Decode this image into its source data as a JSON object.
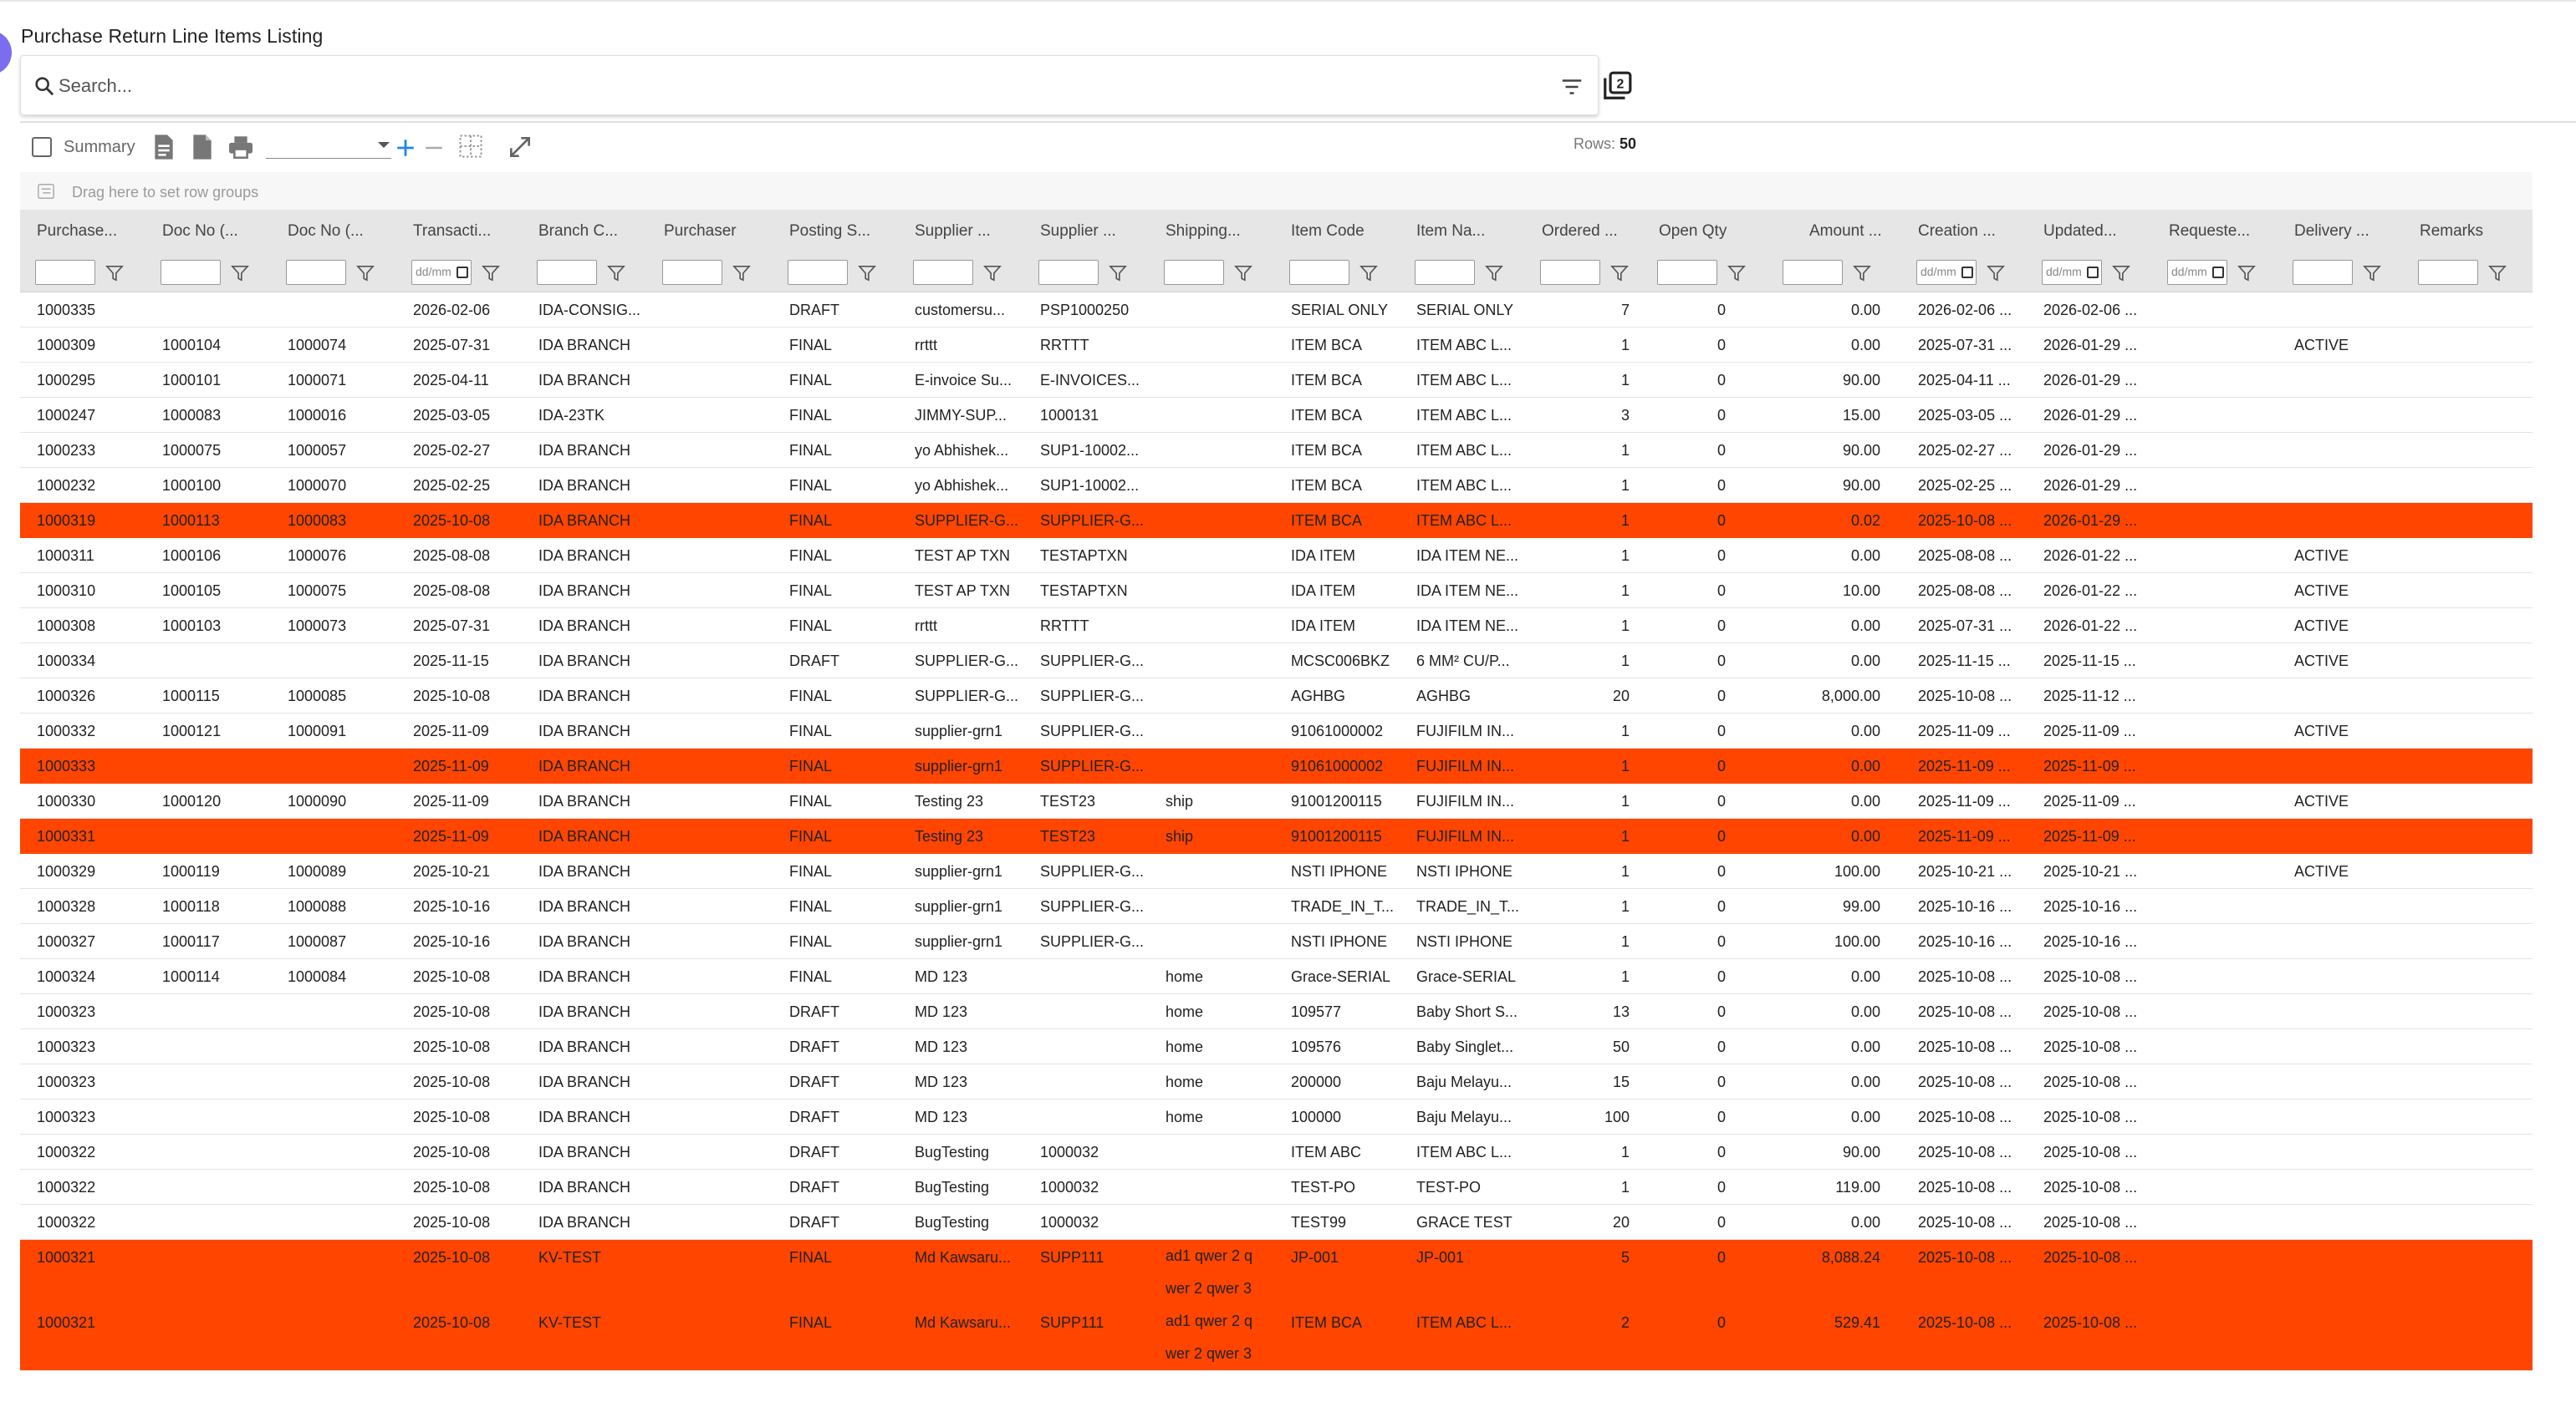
{
  "page": {
    "title": "Purchase Return Line Items Listing"
  },
  "search": {
    "placeholder": "Search..."
  },
  "toolbar": {
    "summary_label": "Summary",
    "rows_label": "Rows:",
    "rows_value": "50"
  },
  "group_panel": {
    "hint": "Drag here to set row groups"
  },
  "colors": {
    "highlight": "#ff4500",
    "header_bg": "#e6e6e6",
    "accent_blue": "#1e88e5"
  },
  "columns": [
    {
      "label": "Purchase...",
      "filter": "text"
    },
    {
      "label": "Doc No (...",
      "filter": "text"
    },
    {
      "label": "Doc No (...",
      "filter": "text"
    },
    {
      "label": "Transacti...",
      "filter": "date"
    },
    {
      "label": "Branch C...",
      "filter": "text"
    },
    {
      "label": "Purchaser",
      "filter": "text"
    },
    {
      "label": "Posting S...",
      "filter": "text"
    },
    {
      "label": "Supplier ...",
      "filter": "text"
    },
    {
      "label": "Supplier ...",
      "filter": "text"
    },
    {
      "label": "Shipping...",
      "filter": "text"
    },
    {
      "label": "Item Code",
      "filter": "text"
    },
    {
      "label": "Item Na...",
      "filter": "text"
    },
    {
      "label": "Ordered ...",
      "filter": "text"
    },
    {
      "label": "Open Qty",
      "filter": "text"
    },
    {
      "label": "Amount ...",
      "filter": "text"
    },
    {
      "label": "Creation ...",
      "filter": "date"
    },
    {
      "label": "Updated...",
      "filter": "date"
    },
    {
      "label": "Requeste...",
      "filter": "date"
    },
    {
      "label": "Delivery ...",
      "filter": "text"
    },
    {
      "label": "Remarks",
      "filter": "text"
    }
  ],
  "date_placeholder": "dd/mm/yyyy",
  "rows": [
    {
      "hl": false,
      "cells": [
        "1000335",
        "",
        "",
        "2026-02-06",
        "IDA-CONSIG...",
        "",
        "DRAFT",
        "customersu...",
        "PSP1000250",
        "",
        "SERIAL ONLY",
        "SERIAL ONLY",
        "7",
        "0",
        "0.00",
        "2026-02-06 ...",
        "2026-02-06 ...",
        "",
        "",
        ""
      ]
    },
    {
      "hl": false,
      "cells": [
        "1000309",
        "1000104",
        "1000074",
        "2025-07-31",
        "IDA BRANCH",
        "",
        "FINAL",
        "rrttt",
        "RRTTT",
        "",
        "ITEM BCA",
        "ITEM ABC L...",
        "1",
        "0",
        "0.00",
        "2025-07-31 ...",
        "2026-01-29 ...",
        "",
        "ACTIVE",
        ""
      ]
    },
    {
      "hl": false,
      "cells": [
        "1000295",
        "1000101",
        "1000071",
        "2025-04-11",
        "IDA BRANCH",
        "",
        "FINAL",
        "E-invoice Su...",
        "E-INVOICES...",
        "",
        "ITEM BCA",
        "ITEM ABC L...",
        "1",
        "0",
        "90.00",
        "2025-04-11 ...",
        "2026-01-29 ...",
        "",
        "",
        ""
      ]
    },
    {
      "hl": false,
      "cells": [
        "1000247",
        "1000083",
        "1000016",
        "2025-03-05",
        "IDA-23TK",
        "",
        "FINAL",
        "JIMMY-SUP...",
        "1000131",
        "",
        "ITEM BCA",
        "ITEM ABC L...",
        "3",
        "0",
        "15.00",
        "2025-03-05 ...",
        "2026-01-29 ...",
        "",
        "",
        ""
      ]
    },
    {
      "hl": false,
      "cells": [
        "1000233",
        "1000075",
        "1000057",
        "2025-02-27",
        "IDA BRANCH",
        "",
        "FINAL",
        "yo Abhishek...",
        "SUP1-10002...",
        "",
        "ITEM BCA",
        "ITEM ABC L...",
        "1",
        "0",
        "90.00",
        "2025-02-27 ...",
        "2026-01-29 ...",
        "",
        "",
        ""
      ]
    },
    {
      "hl": false,
      "cells": [
        "1000232",
        "1000100",
        "1000070",
        "2025-02-25",
        "IDA BRANCH",
        "",
        "FINAL",
        "yo Abhishek...",
        "SUP1-10002...",
        "",
        "ITEM BCA",
        "ITEM ABC L...",
        "1",
        "0",
        "90.00",
        "2025-02-25 ...",
        "2026-01-29 ...",
        "",
        "",
        ""
      ]
    },
    {
      "hl": true,
      "cells": [
        "1000319",
        "1000113",
        "1000083",
        "2025-10-08",
        "IDA BRANCH",
        "",
        "FINAL",
        "SUPPLIER-G...",
        "SUPPLIER-G...",
        "",
        "ITEM BCA",
        "ITEM ABC L...",
        "1",
        "0",
        "0.02",
        "2025-10-08 ...",
        "2026-01-29 ...",
        "",
        "",
        ""
      ]
    },
    {
      "hl": false,
      "cells": [
        "1000311",
        "1000106",
        "1000076",
        "2025-08-08",
        "IDA BRANCH",
        "",
        "FINAL",
        "TEST AP TXN",
        "TESTAPTXN",
        "",
        "IDA ITEM",
        "IDA ITEM NE...",
        "1",
        "0",
        "0.00",
        "2025-08-08 ...",
        "2026-01-22 ...",
        "",
        "ACTIVE",
        ""
      ]
    },
    {
      "hl": false,
      "cells": [
        "1000310",
        "1000105",
        "1000075",
        "2025-08-08",
        "IDA BRANCH",
        "",
        "FINAL",
        "TEST AP TXN",
        "TESTAPTXN",
        "",
        "IDA ITEM",
        "IDA ITEM NE...",
        "1",
        "0",
        "10.00",
        "2025-08-08 ...",
        "2026-01-22 ...",
        "",
        "ACTIVE",
        ""
      ]
    },
    {
      "hl": false,
      "cells": [
        "1000308",
        "1000103",
        "1000073",
        "2025-07-31",
        "IDA BRANCH",
        "",
        "FINAL",
        "rrttt",
        "RRTTT",
        "",
        "IDA ITEM",
        "IDA ITEM NE...",
        "1",
        "0",
        "0.00",
        "2025-07-31 ...",
        "2026-01-22 ...",
        "",
        "ACTIVE",
        ""
      ]
    },
    {
      "hl": false,
      "cells": [
        "1000334",
        "",
        "",
        "2025-11-15",
        "IDA BRANCH",
        "",
        "DRAFT",
        "SUPPLIER-G...",
        "SUPPLIER-G...",
        "",
        "MCSC006BKZ",
        "6 MM² CU/P...",
        "1",
        "0",
        "0.00",
        "2025-11-15 ...",
        "2025-11-15 ...",
        "",
        "ACTIVE",
        ""
      ]
    },
    {
      "hl": false,
      "cells": [
        "1000326",
        "1000115",
        "1000085",
        "2025-10-08",
        "IDA BRANCH",
        "",
        "FINAL",
        "SUPPLIER-G...",
        "SUPPLIER-G...",
        "",
        "AGHBG",
        "AGHBG",
        "20",
        "0",
        "8,000.00",
        "2025-10-08 ...",
        "2025-11-12 ...",
        "",
        "",
        ""
      ]
    },
    {
      "hl": false,
      "cells": [
        "1000332",
        "1000121",
        "1000091",
        "2025-11-09",
        "IDA BRANCH",
        "",
        "FINAL",
        "supplier-grn1",
        "SUPPLIER-G...",
        "",
        "91061000002",
        "FUJIFILM IN...",
        "1",
        "0",
        "0.00",
        "2025-11-09 ...",
        "2025-11-09 ...",
        "",
        "ACTIVE",
        ""
      ]
    },
    {
      "hl": true,
      "cells": [
        "1000333",
        "",
        "",
        "2025-11-09",
        "IDA BRANCH",
        "",
        "FINAL",
        "supplier-grn1",
        "SUPPLIER-G...",
        "",
        "91061000002",
        "FUJIFILM IN...",
        "1",
        "0",
        "0.00",
        "2025-11-09 ...",
        "2025-11-09 ...",
        "",
        "",
        ""
      ]
    },
    {
      "hl": false,
      "cells": [
        "1000330",
        "1000120",
        "1000090",
        "2025-11-09",
        "IDA BRANCH",
        "",
        "FINAL",
        "Testing 23",
        "TEST23",
        "ship",
        "91001200115",
        "FUJIFILM IN...",
        "1",
        "0",
        "0.00",
        "2025-11-09 ...",
        "2025-11-09 ...",
        "",
        "ACTIVE",
        ""
      ]
    },
    {
      "hl": true,
      "cells": [
        "1000331",
        "",
        "",
        "2025-11-09",
        "IDA BRANCH",
        "",
        "FINAL",
        "Testing 23",
        "TEST23",
        "ship",
        "91001200115",
        "FUJIFILM IN...",
        "1",
        "0",
        "0.00",
        "2025-11-09 ...",
        "2025-11-09 ...",
        "",
        "",
        ""
      ]
    },
    {
      "hl": false,
      "cells": [
        "1000329",
        "1000119",
        "1000089",
        "2025-10-21",
        "IDA BRANCH",
        "",
        "FINAL",
        "supplier-grn1",
        "SUPPLIER-G...",
        "",
        "NSTI IPHONE",
        "NSTI IPHONE",
        "1",
        "0",
        "100.00",
        "2025-10-21 ...",
        "2025-10-21 ...",
        "",
        "ACTIVE",
        ""
      ]
    },
    {
      "hl": false,
      "cells": [
        "1000328",
        "1000118",
        "1000088",
        "2025-10-16",
        "IDA BRANCH",
        "",
        "FINAL",
        "supplier-grn1",
        "SUPPLIER-G...",
        "",
        "TRADE_IN_T...",
        "TRADE_IN_T...",
        "1",
        "0",
        "99.00",
        "2025-10-16 ...",
        "2025-10-16 ...",
        "",
        "",
        ""
      ]
    },
    {
      "hl": false,
      "cells": [
        "1000327",
        "1000117",
        "1000087",
        "2025-10-16",
        "IDA BRANCH",
        "",
        "FINAL",
        "supplier-grn1",
        "SUPPLIER-G...",
        "",
        "NSTI IPHONE",
        "NSTI IPHONE",
        "1",
        "0",
        "100.00",
        "2025-10-16 ...",
        "2025-10-16 ...",
        "",
        "",
        ""
      ]
    },
    {
      "hl": false,
      "cells": [
        "1000324",
        "1000114",
        "1000084",
        "2025-10-08",
        "IDA BRANCH",
        "",
        "FINAL",
        "MD 123",
        "",
        "home",
        "Grace-SERIAL",
        "Grace-SERIAL",
        "1",
        "0",
        "0.00",
        "2025-10-08 ...",
        "2025-10-08 ...",
        "",
        "",
        ""
      ]
    },
    {
      "hl": false,
      "cells": [
        "1000323",
        "",
        "",
        "2025-10-08",
        "IDA BRANCH",
        "",
        "DRAFT",
        "MD 123",
        "",
        "home",
        "109577",
        "Baby Short S...",
        "13",
        "0",
        "0.00",
        "2025-10-08 ...",
        "2025-10-08 ...",
        "",
        "",
        ""
      ]
    },
    {
      "hl": false,
      "cells": [
        "1000323",
        "",
        "",
        "2025-10-08",
        "IDA BRANCH",
        "",
        "DRAFT",
        "MD 123",
        "",
        "home",
        "109576",
        "Baby Singlet...",
        "50",
        "0",
        "0.00",
        "2025-10-08 ...",
        "2025-10-08 ...",
        "",
        "",
        ""
      ]
    },
    {
      "hl": false,
      "cells": [
        "1000323",
        "",
        "",
        "2025-10-08",
        "IDA BRANCH",
        "",
        "DRAFT",
        "MD 123",
        "",
        "home",
        "200000",
        "Baju Melayu...",
        "15",
        "0",
        "0.00",
        "2025-10-08 ...",
        "2025-10-08 ...",
        "",
        "",
        ""
      ]
    },
    {
      "hl": false,
      "cells": [
        "1000323",
        "",
        "",
        "2025-10-08",
        "IDA BRANCH",
        "",
        "DRAFT",
        "MD 123",
        "",
        "home",
        "100000",
        "Baju Melayu...",
        "100",
        "0",
        "0.00",
        "2025-10-08 ...",
        "2025-10-08 ...",
        "",
        "",
        ""
      ]
    },
    {
      "hl": false,
      "cells": [
        "1000322",
        "",
        "",
        "2025-10-08",
        "IDA BRANCH",
        "",
        "DRAFT",
        "BugTesting",
        "1000032",
        "",
        "ITEM ABC",
        "ITEM ABC L...",
        "1",
        "0",
        "90.00",
        "2025-10-08 ...",
        "2025-10-08 ...",
        "",
        "",
        ""
      ]
    },
    {
      "hl": false,
      "cells": [
        "1000322",
        "",
        "",
        "2025-10-08",
        "IDA BRANCH",
        "",
        "DRAFT",
        "BugTesting",
        "1000032",
        "",
        "TEST-PO",
        "TEST-PO",
        "1",
        "0",
        "119.00",
        "2025-10-08 ...",
        "2025-10-08 ...",
        "",
        "",
        ""
      ]
    },
    {
      "hl": false,
      "cells": [
        "1000322",
        "",
        "",
        "2025-10-08",
        "IDA BRANCH",
        "",
        "DRAFT",
        "BugTesting",
        "1000032",
        "",
        "TEST99",
        "GRACE TEST",
        "20",
        "0",
        "0.00",
        "2025-10-08 ...",
        "2025-10-08 ...",
        "",
        "",
        ""
      ]
    },
    {
      "hl": true,
      "tall": true,
      "cells": [
        "1000321",
        "",
        "",
        "2025-10-08",
        "KV-TEST",
        "",
        "FINAL",
        "Md Kawsaru...",
        "SUPP111",
        "ad1 qwer 2 q wer 2 qwer 3",
        "JP-001",
        "JP-001",
        "5",
        "0",
        "8,088.24",
        "2025-10-08 ...",
        "2025-10-08 ...",
        "",
        "",
        ""
      ]
    },
    {
      "hl": true,
      "tall": true,
      "cells": [
        "1000321",
        "",
        "",
        "2025-10-08",
        "KV-TEST",
        "",
        "FINAL",
        "Md Kawsaru...",
        "SUPP111",
        "ad1 qwer 2 q wer 2 qwer 3",
        "ITEM BCA",
        "ITEM ABC L...",
        "2",
        "0",
        "529.41",
        "2025-10-08 ...",
        "2025-10-08 ...",
        "",
        "",
        ""
      ]
    }
  ]
}
